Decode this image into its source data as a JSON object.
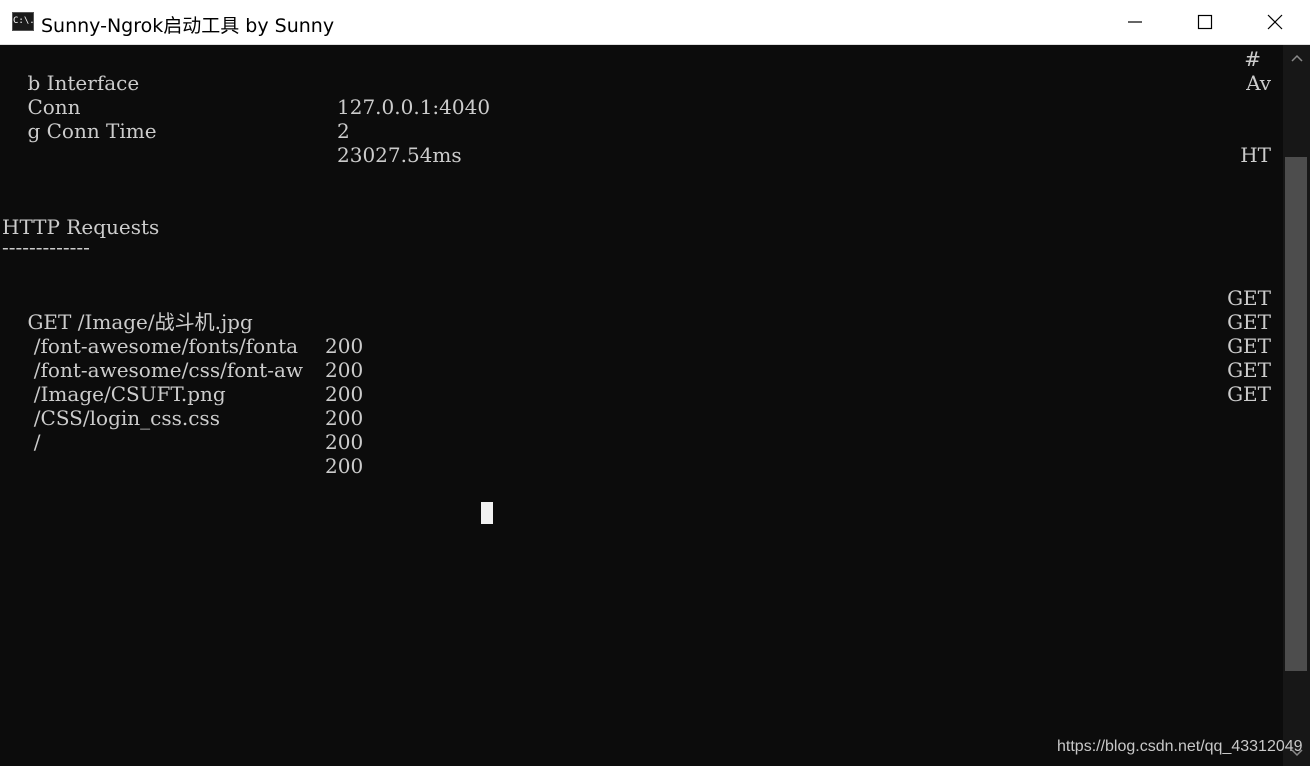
{
  "window": {
    "title": "Sunny-Ngrok启动工具 by Sunny",
    "icon_label": "C:\\."
  },
  "terminal": {
    "status_lines": [
      {
        "label": "b Interface",
        "value": "127.0.0.1:4040"
      },
      {
        "label": "Conn",
        "value": "2"
      },
      {
        "label": "g Conn Time",
        "value": "23027.54ms"
      }
    ],
    "right_fragments": [
      "#",
      "Av",
      "HT"
    ],
    "section_title": "HTTP Requests",
    "section_underline": "-------------",
    "requests": [
      {
        "path": "GET /Image/战斗机.jpg",
        "status": "200",
        "right": "GET"
      },
      {
        "path": " /font-awesome/fonts/fonta",
        "status": "200",
        "right": "GET"
      },
      {
        "path": " /font-awesome/css/font-aw",
        "status": "200",
        "right": "GET"
      },
      {
        "path": " /Image/CSUFT.png",
        "status": "200",
        "right": "GET"
      },
      {
        "path": " /CSS/login_css.css",
        "status": "200",
        "right": "GET"
      },
      {
        "path": " /",
        "status": "200",
        "right": ""
      }
    ]
  },
  "watermark": "https://blog.csdn.net/qq_43312049",
  "colors": {
    "background": "#0c0c0c",
    "text": "#cccccc",
    "titlebar": "#ffffff"
  }
}
